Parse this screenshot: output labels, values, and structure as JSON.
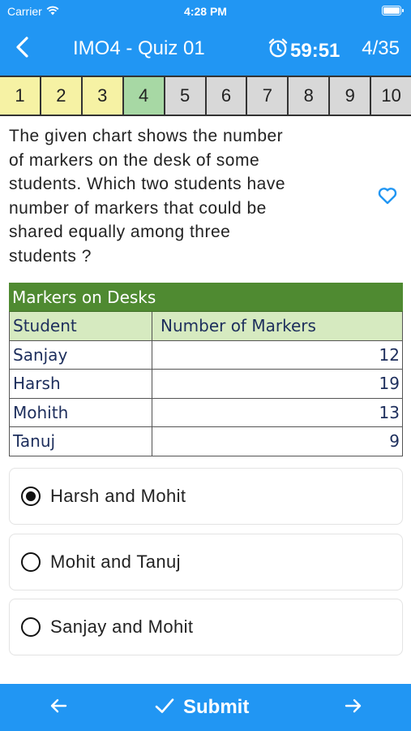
{
  "status_bar": {
    "carrier": "Carrier",
    "time": "4:28 PM"
  },
  "nav": {
    "title": "IMO4 - Quiz 01",
    "timer": "59:51",
    "counter": "4/35"
  },
  "question_nav": [
    {
      "label": "1",
      "state": "answered"
    },
    {
      "label": "2",
      "state": "answered"
    },
    {
      "label": "3",
      "state": "answered"
    },
    {
      "label": "4",
      "state": "current"
    },
    {
      "label": "5",
      "state": "unvisited"
    },
    {
      "label": "6",
      "state": "unvisited"
    },
    {
      "label": "7",
      "state": "unvisited"
    },
    {
      "label": "8",
      "state": "unvisited"
    },
    {
      "label": "9",
      "state": "unvisited"
    },
    {
      "label": "10",
      "state": "unvisited"
    }
  ],
  "question": {
    "lines": [
      "The given chart shows the number",
      "of markers on the desk of some",
      "students. Which two students have",
      "number of markers that could be",
      "shared equally among three",
      "students ?"
    ]
  },
  "table": {
    "title": "Markers on Desks",
    "headers": [
      "Student",
      "Number of Markers"
    ],
    "rows": [
      [
        "Sanjay",
        "12"
      ],
      [
        "Harsh",
        "19"
      ],
      [
        "Mohith",
        "13"
      ],
      [
        "Tanuj",
        "9"
      ]
    ]
  },
  "options": [
    {
      "label": "Harsh and Mohit",
      "selected": true
    },
    {
      "label": "Mohit and Tanuj",
      "selected": false
    },
    {
      "label": "Sanjay and Mohit",
      "selected": false
    }
  ],
  "bottom_bar": {
    "submit_label": "Submit"
  },
  "colors": {
    "primary": "#2196f3",
    "answered": "#f6f2a4",
    "current": "#a7d8a4",
    "unvisited": "#d8d8d8",
    "table_title": "#4f8a31",
    "table_header": "#d6eac0"
  },
  "icons": {
    "wifi": "wifi-icon",
    "battery": "battery-icon",
    "back": "chevron-left-icon",
    "alarm": "alarm-clock-icon",
    "favorite": "heart-outline-icon",
    "prev": "arrow-left-icon",
    "submit": "checkmark-icon",
    "next": "arrow-right-icon"
  }
}
